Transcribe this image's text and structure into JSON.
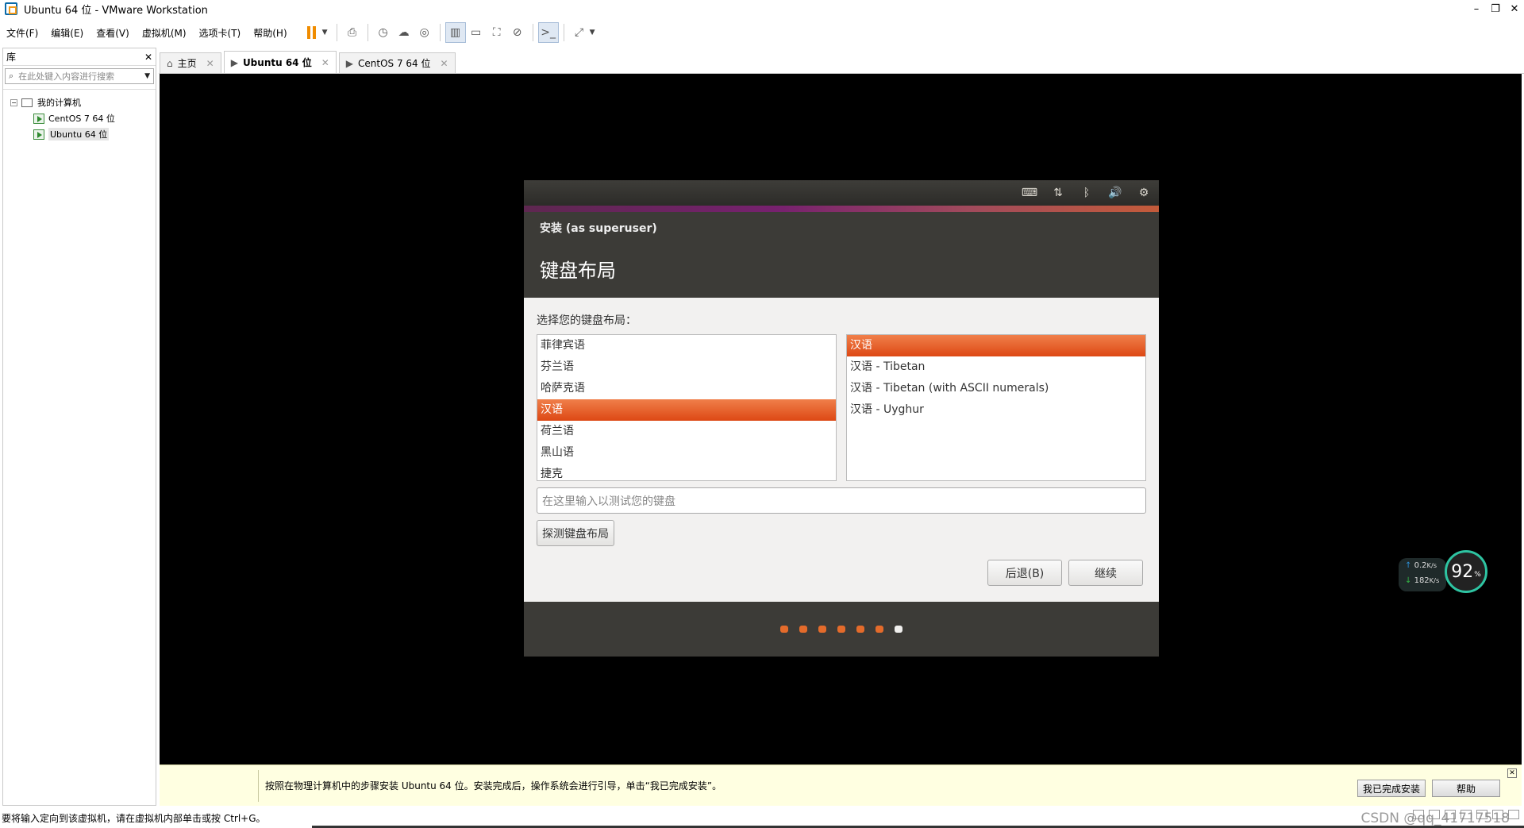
{
  "window": {
    "title": "Ubuntu 64 位 - VMware Workstation"
  },
  "menu": [
    "文件(F)",
    "编辑(E)",
    "查看(V)",
    "虚拟机(M)",
    "选项卡(T)",
    "帮助(H)"
  ],
  "sidebar": {
    "title": "库",
    "search_placeholder": "在此处键入内容进行搜索",
    "tree_root": "我的计算机",
    "vms": [
      "CentOS 7 64 位",
      "Ubuntu 64 位"
    ],
    "selected_vm": "Ubuntu 64 位"
  },
  "tabs": [
    {
      "label": "主页"
    },
    {
      "label": "Ubuntu 64 位",
      "active": true
    },
    {
      "label": "CentOS 7 64 位"
    }
  ],
  "installer": {
    "subtitle": "安装 (as superuser)",
    "heading": "键盘布局",
    "prompt": "选择您的键盘布局：",
    "layouts": [
      "菲律宾语",
      "芬兰语",
      "哈萨克语",
      "汉语",
      "荷兰语",
      "黑山语",
      "捷克"
    ],
    "selected_layout": "汉语",
    "variants": [
      "汉语",
      "汉语 - Tibetan",
      "汉语 - Tibetan (with ASCII numerals)",
      "汉语 - Uyghur"
    ],
    "selected_variant": "汉语",
    "test_placeholder": "在这里输入以测试您的键盘",
    "detect_label": "探测键盘布局",
    "back_label": "后退(B)",
    "continue_label": "继续",
    "progress": {
      "total_steps": 7,
      "current_step": 7
    }
  },
  "net_monitor": {
    "upload": "0.2",
    "upload_unit": "K/s",
    "download": "182",
    "download_unit": "K/s",
    "percent": "92",
    "percent_unit": "%"
  },
  "notice": {
    "message": "按照在物理计算机中的步骤安装 Ubuntu 64 位。安装完成后，操作系统会进行引导，单击“我已完成安装”。",
    "done_label": "我已完成安装",
    "help_label": "帮助"
  },
  "status": {
    "text": "要将输入定向到该虚拟机，请在虚拟机内部单击或按 Ctrl+G。",
    "watermark": "CSDN @qq_41717518"
  },
  "colors": {
    "accent": "#dd4814",
    "header": "#3c3b37",
    "vm_bg": "#000000",
    "notice_bg": "#ffffe1"
  }
}
